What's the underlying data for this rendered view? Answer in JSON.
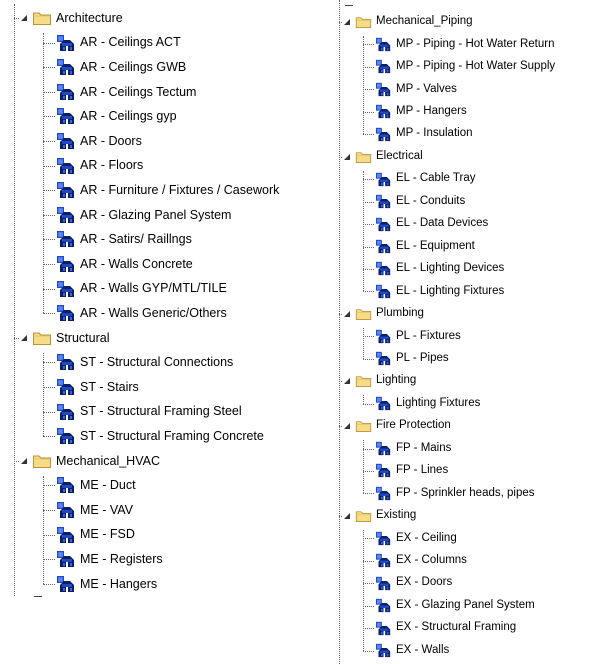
{
  "left_tree": [
    {
      "label": "Architecture",
      "items": [
        "AR - Ceilings ACT",
        "AR - Ceilings GWB",
        "AR - Ceilings Tectum",
        "AR - Ceilings gyp",
        "AR - Doors",
        "AR - Floors",
        "AR - Furniture / Fixtures / Casework",
        "AR - Glazing Panel System",
        "AR - Satirs/ Raillngs",
        "AR - Walls Concrete",
        "AR - Walls GYP/MTL/TILE",
        "AR - Walls Generic/Others"
      ]
    },
    {
      "label": "Structural",
      "items": [
        "ST - Structural Connections",
        "ST - Stairs",
        "ST - Structural Framing Steel",
        "ST - Structural Framing Concrete"
      ]
    },
    {
      "label": "Mechanical_HVAC",
      "items": [
        "ME - Duct",
        "ME - VAV",
        "ME - FSD",
        "ME - Registers",
        "ME - Hangers"
      ]
    }
  ],
  "right_tree": [
    {
      "label": "Mechanical_Piping",
      "items": [
        "MP - Piping - Hot Water Return",
        "MP - Piping - Hot Water Supply",
        "MP - Valves",
        "MP - Hangers",
        "MP - Insulation"
      ]
    },
    {
      "label": "Electrical",
      "items": [
        "EL - Cable Tray",
        "EL - Conduits",
        "EL - Data Devices",
        "EL - Equipment",
        "EL - Lighting Devices",
        "EL - Lighting Fixtures"
      ]
    },
    {
      "label": "Plumbing",
      "items": [
        "PL - Fixtures",
        "PL - Pipes"
      ]
    },
    {
      "label": "Lighting",
      "items": [
        "Lighting Fixtures"
      ]
    },
    {
      "label": "Fire Protection",
      "items": [
        "FP - Mains",
        "FP - Lines",
        "FP - Sprinkler heads, pipes"
      ]
    },
    {
      "label": "Existing",
      "items": [
        "EX - Ceiling",
        "EX - Columns",
        "EX - Doors",
        "EX - Glazing Panel System",
        "EX - Structural Framing",
        "EX - Walls"
      ]
    }
  ],
  "icons": {
    "group_expander": "expanded-triangle-icon",
    "group": "folder-icon",
    "item": "selection-set-icon"
  },
  "colors": {
    "folder_fill": "#f6dc86",
    "folder_stroke": "#b9923a",
    "selset_blue": "#1f49c7",
    "selset_dark": "#0a1f66",
    "tree_lines": "#666666"
  }
}
